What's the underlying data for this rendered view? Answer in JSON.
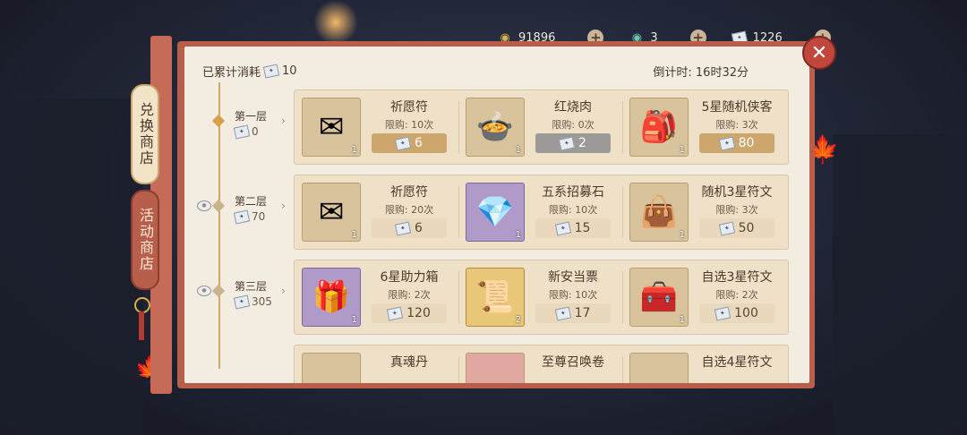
{
  "currencies": [
    {
      "icon": "jade-coin-icon",
      "value": "91896"
    },
    {
      "icon": "jade-dragon-icon",
      "value": "3"
    },
    {
      "icon": "ticket-icon",
      "value": "1226"
    }
  ],
  "tabs": {
    "active": "兑换商店",
    "inactive": "活动商店"
  },
  "header": {
    "consumed_label": "已累计消耗",
    "consumed_value": "10",
    "countdown": "倒计时: 16时32分"
  },
  "tiers": [
    {
      "label": "第一层",
      "cost": "0",
      "items": [
        {
          "name": "祈愿符",
          "limit": "限购: 10次",
          "price": "6",
          "qty": "1",
          "icon": "✉",
          "price_style": "gold",
          "thumb_style": ""
        },
        {
          "name": "红烧肉",
          "limit": "限购: 0次",
          "price": "2",
          "qty": "1",
          "icon": "🍲",
          "price_style": "grey",
          "thumb_style": ""
        },
        {
          "name": "5星随机侠客",
          "limit": "限购: 3次",
          "price": "80",
          "qty": "1",
          "icon": "🎒",
          "price_style": "gold",
          "thumb_style": ""
        }
      ]
    },
    {
      "label": "第二层",
      "cost": "70",
      "items": [
        {
          "name": "祈愿符",
          "limit": "限购: 20次",
          "price": "6",
          "qty": "1",
          "icon": "✉",
          "price_style": "plain",
          "thumb_style": ""
        },
        {
          "name": "五系招募石",
          "limit": "限购: 10次",
          "price": "15",
          "qty": "1",
          "icon": "💎",
          "price_style": "plain",
          "thumb_style": "purple"
        },
        {
          "name": "随机3星符文",
          "limit": "限购: 3次",
          "price": "50",
          "qty": "1",
          "icon": "👜",
          "price_style": "plain",
          "thumb_style": ""
        }
      ]
    },
    {
      "label": "第三层",
      "cost": "305",
      "items": [
        {
          "name": "6星助力箱",
          "limit": "限购: 2次",
          "price": "120",
          "qty": "1",
          "icon": "🎁",
          "price_style": "plain",
          "thumb_style": "purple"
        },
        {
          "name": "新安当票",
          "limit": "限购: 10次",
          "price": "17",
          "qty": "2",
          "icon": "📜",
          "price_style": "plain",
          "thumb_style": "gold"
        },
        {
          "name": "自选3星符文",
          "limit": "限购: 2次",
          "price": "100",
          "qty": "1",
          "icon": "🧰",
          "price_style": "plain",
          "thumb_style": ""
        }
      ]
    },
    {
      "label": "",
      "cost": "",
      "items": [
        {
          "name": "真魂丹",
          "limit": "",
          "price": "",
          "qty": "",
          "icon": "",
          "price_style": "plain",
          "thumb_style": ""
        },
        {
          "name": "至尊召唤卷",
          "limit": "",
          "price": "",
          "qty": "",
          "icon": "",
          "price_style": "plain",
          "thumb_style": ""
        },
        {
          "name": "自选4星符文",
          "limit": "",
          "price": "",
          "qty": "",
          "icon": "",
          "price_style": "plain",
          "thumb_style": ""
        }
      ]
    }
  ]
}
